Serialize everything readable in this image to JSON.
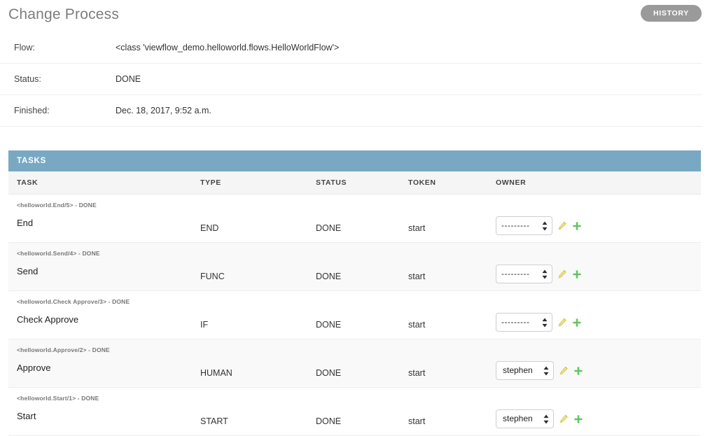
{
  "header": {
    "title": "Change Process",
    "history_label": "HISTORY"
  },
  "info": {
    "rows": [
      {
        "label": "Flow:",
        "value": "<class 'viewflow_demo.helloworld.flows.HelloWorldFlow'>"
      },
      {
        "label": "Status:",
        "value": "DONE"
      },
      {
        "label": "Finished:",
        "value": "Dec. 18, 2017, 9:52 a.m."
      }
    ]
  },
  "tasks": {
    "panel_title": "TASKS",
    "columns": [
      "TASK",
      "TYPE",
      "STATUS",
      "TOKEN",
      "OWNER"
    ],
    "rows": [
      {
        "meta": "<helloworld.End/5> - DONE",
        "task": "End",
        "type": "END",
        "status": "DONE",
        "token": "start",
        "owner": "---------",
        "owner_is_placeholder": true,
        "edit_icon": "pencil-icon",
        "add_icon": "plus-icon"
      },
      {
        "meta": "<helloworld.Send/4> - DONE",
        "task": "Send",
        "type": "FUNC",
        "status": "DONE",
        "token": "start",
        "owner": "---------",
        "owner_is_placeholder": true,
        "edit_icon": "pencil-icon",
        "add_icon": "plus-icon"
      },
      {
        "meta": "<helloworld.Check Approve/3> - DONE",
        "task": "Check Approve",
        "type": "IF",
        "status": "DONE",
        "token": "start",
        "owner": "---------",
        "owner_is_placeholder": true,
        "edit_icon": "pencil-icon",
        "add_icon": "plus-icon"
      },
      {
        "meta": "<helloworld.Approve/2> - DONE",
        "task": "Approve",
        "type": "HUMAN",
        "status": "DONE",
        "token": "start",
        "owner": "stephen",
        "owner_is_placeholder": false,
        "edit_icon": "pencil-icon",
        "add_icon": "plus-icon"
      },
      {
        "meta": "<helloworld.Start/1> - DONE",
        "task": "Start",
        "type": "START",
        "status": "DONE",
        "token": "start",
        "owner": "stephen",
        "owner_is_placeholder": false,
        "edit_icon": "pencil-icon",
        "add_icon": "plus-icon"
      }
    ]
  },
  "colors": {
    "panel_header": "#79a8c3",
    "history_button": "#9a9a9a",
    "add_icon": "#62c462",
    "edit_icon": "#e8d36a",
    "row_stripe": "#f9f9f9"
  }
}
